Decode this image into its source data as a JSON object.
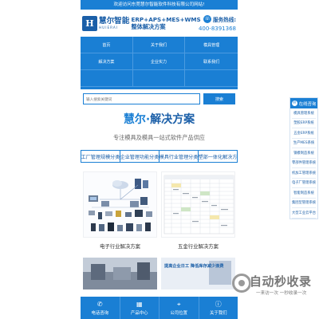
{
  "welcome_text": "欢迎访问东莞慧尔智能软件科技有限公司网站!",
  "header": {
    "logo_mark": "H",
    "logo_cn": "慧尔智能",
    "logo_en": "HUIERAI",
    "tagline_1": "ERP+APS+MES+WMS",
    "tagline_2": "整体解决方案",
    "hotline_label": "服务热线:",
    "hotline_number": "400-8391368"
  },
  "nav": {
    "items": [
      {
        "label": "首页"
      },
      {
        "label": "关于我们"
      },
      {
        "label": "模具管理"
      },
      {
        "label": "解决方案"
      },
      {
        "label": "企业实力"
      },
      {
        "label": "联系我们"
      }
    ]
  },
  "search": {
    "placeholder": "输入搜索关键词",
    "button_label": "搜索"
  },
  "solutions": {
    "title_main": "慧尔",
    "title_dot": "·",
    "title_rest": "解决方案",
    "subtitle": "专注模具及模具一站式软件产品供应",
    "categories": [
      "工厂管理规模分类",
      "企业管理功能分类",
      "模具行业管理分类",
      "塑部一体化解决方"
    ],
    "products": [
      {
        "caption": "电子行业解决方案"
      },
      {
        "caption": "五金行业解决方案"
      }
    ],
    "promo_text": "提高企业日工 降低库存减少浪费"
  },
  "bottom_bar": {
    "items": [
      {
        "label": "电话咨询",
        "icon": "phone-icon"
      },
      {
        "label": "产品中心",
        "icon": "grid-icon"
      },
      {
        "label": "公司位置",
        "icon": "map-pin-icon"
      },
      {
        "label": "关于我们",
        "icon": "info-icon"
      }
    ]
  },
  "side_panel": {
    "title": "在线咨询",
    "items": [
      "模具管理系统",
      "塑胶ERP系统",
      "五金ERP系统",
      "生产MES系统",
      "钢模制造系统",
      "零部件管理系统",
      "机加工管理系统",
      "电子厂管理系统",
      "智能制造系统",
      "集团型管理系统",
      "大型工业云平台"
    ]
  },
  "watermark": {
    "title": "自动秒收录",
    "subtitle": "一来访一次 一秒收录一次"
  },
  "colors": {
    "brand_blue": "#1a7fd4",
    "dark_blue": "#1b5fa8"
  }
}
